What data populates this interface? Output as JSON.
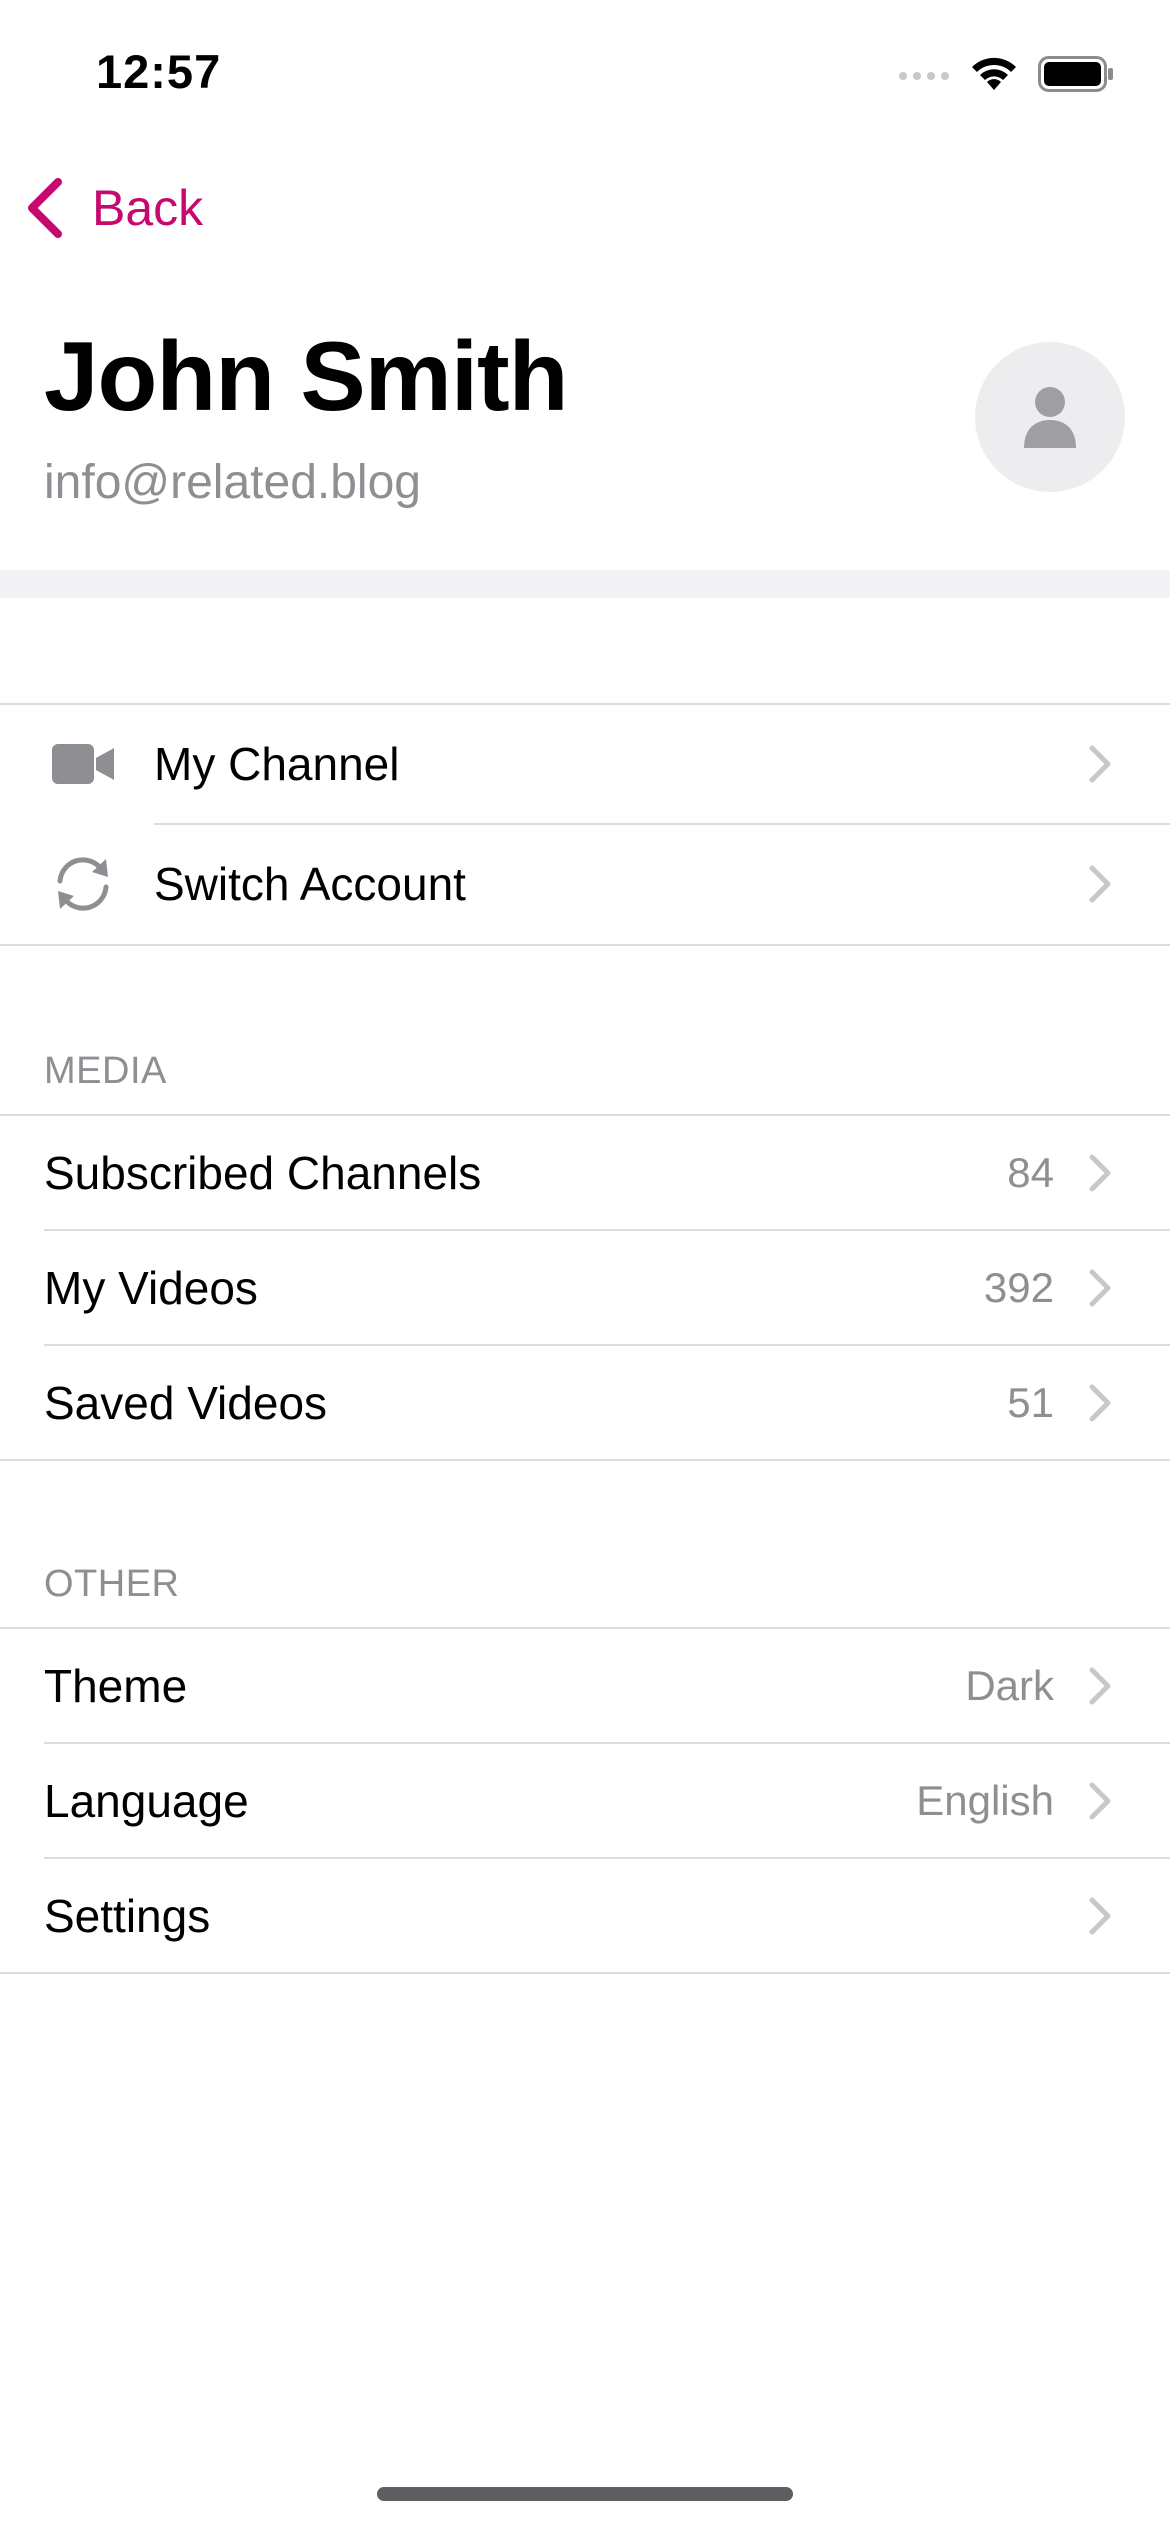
{
  "status_bar": {
    "time": "12:57"
  },
  "nav": {
    "back_label": "Back"
  },
  "profile": {
    "name": "John Smith",
    "email": "info@related.blog",
    "avatar_icon": "person-icon"
  },
  "account_rows": [
    {
      "label": "My Channel",
      "icon": "video-camera-icon"
    },
    {
      "label": "Switch Account",
      "icon": "refresh-icon"
    }
  ],
  "media_section": {
    "header": "MEDIA",
    "rows": [
      {
        "label": "Subscribed Channels",
        "value": "84"
      },
      {
        "label": "My Videos",
        "value": "392"
      },
      {
        "label": "Saved Videos",
        "value": "51"
      }
    ]
  },
  "other_section": {
    "header": "OTHER",
    "rows": [
      {
        "label": "Theme",
        "value": "Dark"
      },
      {
        "label": "Language",
        "value": "English"
      },
      {
        "label": "Settings",
        "value": ""
      }
    ]
  },
  "colors": {
    "accent": "#c5096f",
    "secondary_text": "#8e8e93",
    "separator": "#dcdcde",
    "band": "#f2f2f7"
  }
}
